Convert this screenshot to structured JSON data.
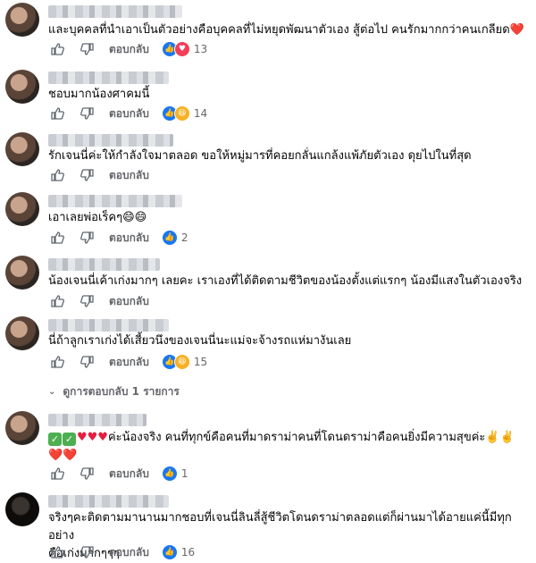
{
  "reply_label": "ตอบกลับ",
  "comments": [
    {
      "text": "และบุคคลที่นำเอาเป็นตัวอย่างคือบุคคลที่ไม่หยุดพัฒนาตัวเอง สู้ต่อไป คนรักมากกว่าคนเกลียด",
      "emoji": "❤️",
      "reactions": [
        "like",
        "love"
      ],
      "count": "13"
    },
    {
      "text": "ชอบมากน้องศาคมนี้",
      "reactions": [
        "like",
        "haha"
      ],
      "count": "14"
    },
    {
      "text": "รักเจนนี่ค่ะให้กำลังใจมาตลอด ขอให้หมู่มารที่คอยกลั่นแกล้งแพ้ภัยตัวเอง ดุยไปในที่สุด",
      "reactions": [],
      "count": ""
    },
    {
      "text": "เอาเลยพ่อเร็คๆ",
      "emoji": "😄😄",
      "reactions": [
        "like"
      ],
      "count": "2"
    },
    {
      "text": "น้องเจนนี่เค้าเก่งมากๆ เลยคะ เราเองที่ได้ติดตามชีวิตของน้องตั้งแต่แรกๆ น้องมีแสงในตัวเองจริง",
      "reactions": [],
      "count": ""
    },
    {
      "text": "นี่ถ้าลูกเราเก่งได้เสี้ยวนึงของเจนนี่นะแม่จะจ้างรถแห่มางันเลย",
      "reactions": [
        "like",
        "haha"
      ],
      "count": "15"
    },
    {
      "text_before": "",
      "text_mid": "ค่ะน้องจริง คนที่ทุกข์คือคนที่มาดราม่าคนที่โดนดราม่าคือคนยิ่งมีความสุขค่ะ",
      "emoji_end": "✌️✌️",
      "line2_emoji": "❤️❤️",
      "reactions": [
        "like"
      ],
      "count": "1"
    },
    {
      "text": "จริงๆคะติดตามมานานมากชอบที่เจนนี่ลินลี่สู้ชีวิตโดนดราม่าตลอดแต่ก็ผ่านมาได้อายแค่นี้มีทุกอย่าง\nคือเก่งมากๆๆๆ",
      "reactions": [
        "like"
      ],
      "count": "16"
    }
  ],
  "view_replies": "ดูการตอบกลับ 1 รายการ"
}
